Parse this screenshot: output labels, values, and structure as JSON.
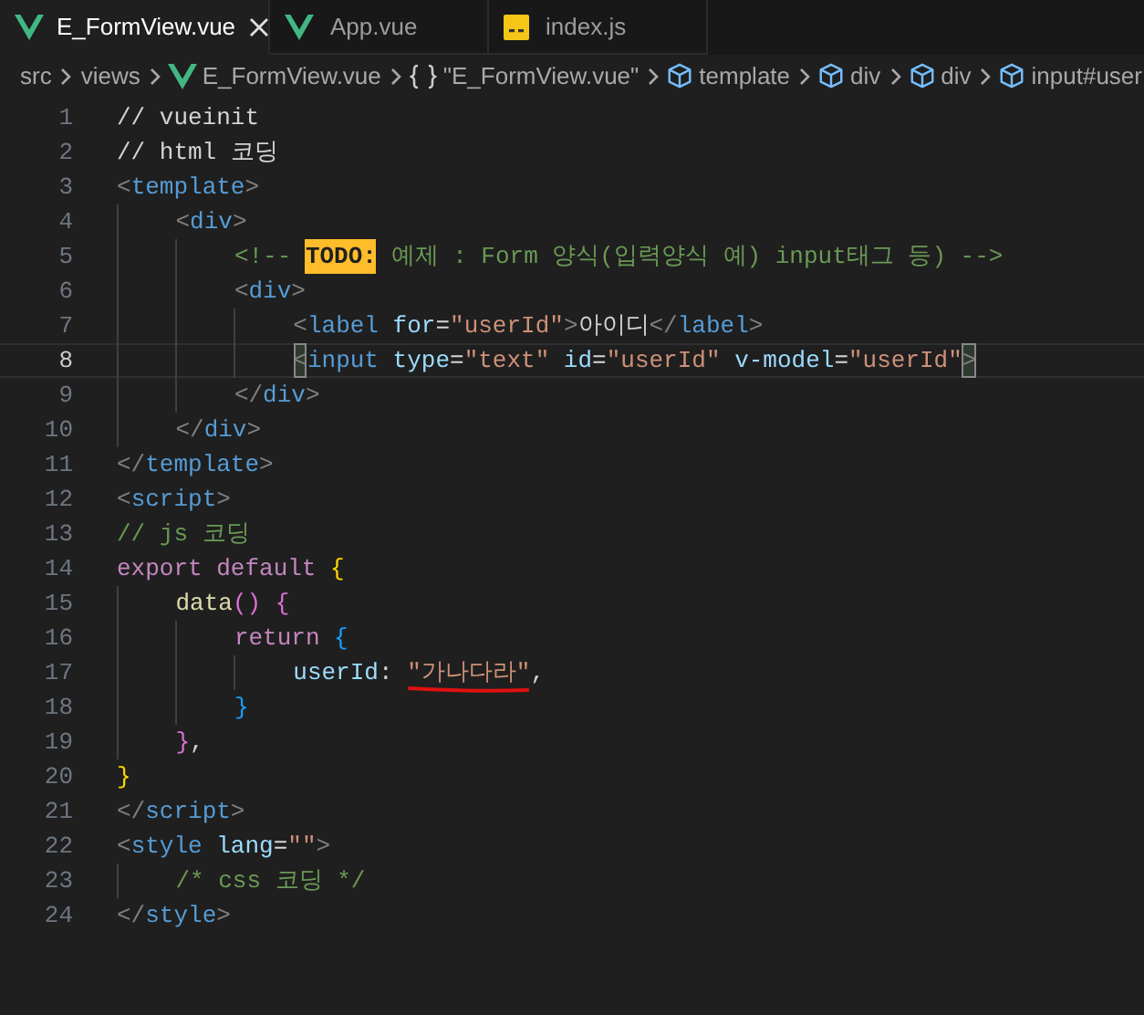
{
  "tabs": [
    {
      "label": "E_FormView.vue",
      "kind": "vue",
      "selected": true
    },
    {
      "label": "App.vue",
      "kind": "vue",
      "selected": false
    },
    {
      "label": "index.js",
      "kind": "js",
      "selected": false
    }
  ],
  "breadcrumbs": [
    {
      "label": "src",
      "kind": "folder"
    },
    {
      "label": "views",
      "kind": "folder"
    },
    {
      "label": "E_FormView.vue",
      "kind": "vue"
    },
    {
      "label": "\"E_FormView.vue\"",
      "kind": "module"
    },
    {
      "label": "template",
      "kind": "element"
    },
    {
      "label": "div",
      "kind": "element"
    },
    {
      "label": "div",
      "kind": "element"
    },
    {
      "label": "input#user",
      "kind": "element"
    }
  ],
  "lines": [
    {
      "number": "1",
      "current": false,
      "tokens": [
        {
          "text": "// vueinit",
          "kind": "text"
        }
      ]
    },
    {
      "number": "2",
      "current": false,
      "tokens": [
        {
          "text": "// html 코딩",
          "kind": "text"
        }
      ]
    },
    {
      "number": "3",
      "current": false,
      "tokens": [
        {
          "text": "<",
          "kind": "punct"
        },
        {
          "text": "template",
          "kind": "tag"
        },
        {
          "text": ">",
          "kind": "punct"
        }
      ]
    },
    {
      "number": "4",
      "current": false,
      "tokens": [
        {
          "text": "    <",
          "kind": "punct"
        },
        {
          "text": "div",
          "kind": "tag"
        },
        {
          "text": ">",
          "kind": "punct"
        }
      ]
    },
    {
      "number": "5",
      "current": false,
      "tokens": [
        {
          "text": "        <!-- ",
          "kind": "comment"
        },
        {
          "text": "TODO:",
          "kind": "todo"
        },
        {
          "text": " 예제 : Form 양식(입력양식 예) input태그 등) -->",
          "kind": "comment"
        }
      ]
    },
    {
      "number": "6",
      "current": false,
      "tokens": [
        {
          "text": "        <",
          "kind": "punct"
        },
        {
          "text": "div",
          "kind": "tag"
        },
        {
          "text": ">",
          "kind": "punct"
        }
      ]
    },
    {
      "number": "7",
      "current": false,
      "tokens": [
        {
          "text": "            <",
          "kind": "punct"
        },
        {
          "text": "label",
          "kind": "tag"
        },
        {
          "text": " for",
          "kind": "attr"
        },
        {
          "text": "=",
          "kind": "text"
        },
        {
          "text": "\"userId\"",
          "kind": "string"
        },
        {
          "text": ">",
          "kind": "punct"
        },
        {
          "text": "아이디",
          "kind": "text"
        },
        {
          "text": "</",
          "kind": "punct"
        },
        {
          "text": "label",
          "kind": "tag"
        },
        {
          "text": ">",
          "kind": "punct"
        }
      ]
    },
    {
      "number": "8",
      "current": true,
      "tokens": [
        {
          "text": "            <",
          "kind": "punct",
          "match": true
        },
        {
          "text": "input",
          "kind": "tag"
        },
        {
          "text": " type",
          "kind": "attr"
        },
        {
          "text": "=",
          "kind": "text"
        },
        {
          "text": "\"text\"",
          "kind": "string"
        },
        {
          "text": " id",
          "kind": "attr"
        },
        {
          "text": "=",
          "kind": "text"
        },
        {
          "text": "\"userId\"",
          "kind": "string"
        },
        {
          "text": " v-model",
          "kind": "attr"
        },
        {
          "text": "=",
          "kind": "text"
        },
        {
          "text": "\"userId\"",
          "kind": "string"
        },
        {
          "text": ">",
          "kind": "punct",
          "match": true
        }
      ]
    },
    {
      "number": "9",
      "current": false,
      "tokens": [
        {
          "text": "        </",
          "kind": "punct"
        },
        {
          "text": "div",
          "kind": "tag"
        },
        {
          "text": ">",
          "kind": "punct"
        }
      ]
    },
    {
      "number": "10",
      "current": false,
      "tokens": [
        {
          "text": "    </",
          "kind": "punct"
        },
        {
          "text": "div",
          "kind": "tag"
        },
        {
          "text": ">",
          "kind": "punct"
        }
      ]
    },
    {
      "number": "11",
      "current": false,
      "tokens": [
        {
          "text": "</",
          "kind": "punct"
        },
        {
          "text": "template",
          "kind": "tag"
        },
        {
          "text": ">",
          "kind": "punct"
        }
      ]
    },
    {
      "number": "12",
      "current": false,
      "tokens": [
        {
          "text": "<",
          "kind": "punct"
        },
        {
          "text": "script",
          "kind": "tag"
        },
        {
          "text": ">",
          "kind": "punct"
        }
      ]
    },
    {
      "number": "13",
      "current": false,
      "tokens": [
        {
          "text": "// js 코딩",
          "kind": "comment"
        }
      ]
    },
    {
      "number": "14",
      "current": false,
      "tokens": [
        {
          "text": "export",
          "kind": "keyword"
        },
        {
          "text": " default",
          "kind": "keyword"
        },
        {
          "text": " {",
          "kind": "brace1"
        }
      ]
    },
    {
      "number": "15",
      "current": false,
      "tokens": [
        {
          "text": "    data",
          "kind": "func"
        },
        {
          "text": "()",
          "kind": "brace2"
        },
        {
          "text": " {",
          "kind": "brace2"
        }
      ]
    },
    {
      "number": "16",
      "current": false,
      "tokens": [
        {
          "text": "        return",
          "kind": "keyword"
        },
        {
          "text": " {",
          "kind": "brace3"
        }
      ]
    },
    {
      "number": "17",
      "current": false,
      "tokens": [
        {
          "text": "            userId",
          "kind": "attr"
        },
        {
          "text": ": ",
          "kind": "text"
        },
        {
          "text": "\"가나다라\"",
          "kind": "string",
          "underline": true
        },
        {
          "text": ",",
          "kind": "text"
        }
      ]
    },
    {
      "number": "18",
      "current": false,
      "tokens": [
        {
          "text": "        }",
          "kind": "brace3"
        }
      ]
    },
    {
      "number": "19",
      "current": false,
      "tokens": [
        {
          "text": "    }",
          "kind": "brace2"
        },
        {
          "text": ",",
          "kind": "text"
        }
      ]
    },
    {
      "number": "20",
      "current": false,
      "tokens": [
        {
          "text": "}",
          "kind": "brace1"
        }
      ]
    },
    {
      "number": "21",
      "current": false,
      "tokens": [
        {
          "text": "</",
          "kind": "punct"
        },
        {
          "text": "script",
          "kind": "tag"
        },
        {
          "text": ">",
          "kind": "punct"
        }
      ]
    },
    {
      "number": "22",
      "current": false,
      "tokens": [
        {
          "text": "<",
          "kind": "punct"
        },
        {
          "text": "style",
          "kind": "tag"
        },
        {
          "text": " lang",
          "kind": "attr"
        },
        {
          "text": "=",
          "kind": "text"
        },
        {
          "text": "\"\"",
          "kind": "string"
        },
        {
          "text": ">",
          "kind": "punct"
        }
      ]
    },
    {
      "number": "23",
      "current": false,
      "tokens": [
        {
          "text": "    /* css 코딩 */",
          "kind": "comment"
        }
      ]
    },
    {
      "number": "24",
      "current": false,
      "tokens": [
        {
          "text": "</",
          "kind": "punct"
        },
        {
          "text": "style",
          "kind": "tag"
        },
        {
          "text": ">",
          "kind": "punct"
        }
      ]
    }
  ]
}
